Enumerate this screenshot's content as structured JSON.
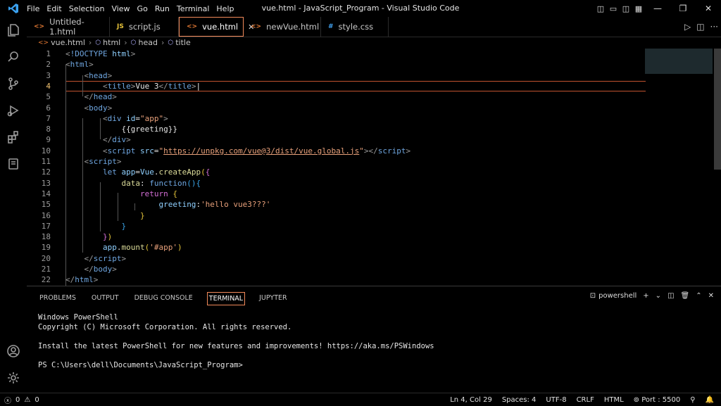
{
  "window": {
    "title": "vue.html - JavaScript_Program - Visual Studio Code"
  },
  "menu": [
    "File",
    "Edit",
    "Selection",
    "View",
    "Go",
    "Run",
    "Terminal",
    "Help"
  ],
  "tabs": [
    {
      "label": "Untitled-1.html",
      "icon": "<>",
      "icon_color": "#e37933"
    },
    {
      "label": "script.js",
      "icon": "JS",
      "icon_color": "#e8c33a"
    },
    {
      "label": "vue.html",
      "icon": "<>",
      "icon_color": "#e37933",
      "active": true
    },
    {
      "label": "newVue.html",
      "icon": "<>",
      "icon_color": "#e37933"
    },
    {
      "label": "style.css",
      "icon": "#",
      "icon_color": "#42a5f5"
    }
  ],
  "breadcrumb": [
    "vue.html",
    "html",
    "head",
    "title"
  ],
  "editor": {
    "line_numbers": [
      "1",
      "2",
      "3",
      "4",
      "5",
      "6",
      "7",
      "8",
      "9",
      "10",
      "11",
      "12",
      "13",
      "14",
      "15",
      "16",
      "17",
      "18",
      "19",
      "20",
      "21",
      "22"
    ],
    "current_line": 4
  },
  "panel": {
    "tabs": [
      "PROBLEMS",
      "OUTPUT",
      "DEBUG CONSOLE",
      "TERMINAL",
      "JUPYTER"
    ],
    "active_tab": "TERMINAL",
    "shell": "powershell",
    "terminal_lines": [
      "Windows PowerShell",
      "Copyright (C) Microsoft Corporation. All rights reserved.",
      "",
      "Install the latest PowerShell for new features and improvements! https://aka.ms/PSWindows",
      "",
      "PS C:\\Users\\dell\\Documents\\JavaScript_Program>"
    ]
  },
  "status": {
    "errors": "0",
    "warnings": "0",
    "position": "Ln 4, Col 29",
    "spaces": "Spaces: 4",
    "encoding": "UTF-8",
    "eol": "CRLF",
    "language": "HTML",
    "port": "Port : 5500"
  },
  "colors": {
    "accent": "#f28a5a",
    "tag": "#6fa6e0",
    "string": "#e7a07a",
    "attribute": "#8fd0ff"
  }
}
